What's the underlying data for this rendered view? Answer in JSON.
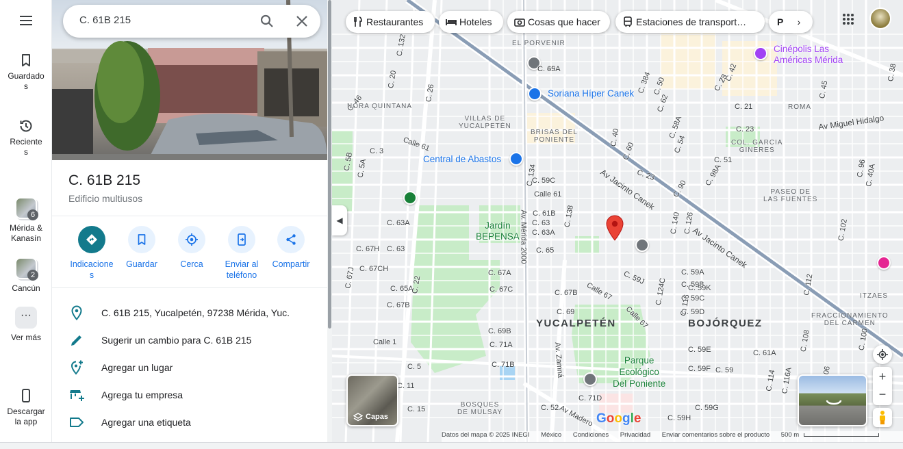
{
  "rail": {
    "menu_icon": "hamburger-menu-icon",
    "saved_label": "Guardado\ns",
    "recent_label": "Reciente\ns",
    "merida_label": "Mérida &\nKanasín",
    "merida_count": "6",
    "cancun_label": "Cancún",
    "cancun_count": "2",
    "more_label": "Ver más",
    "more_glyph": "···",
    "download_label": "Descargar\nla app"
  },
  "search": {
    "value": "C. 61B 215"
  },
  "place": {
    "title": "C. 61B 215",
    "type": "Edificio multiusos"
  },
  "actions": [
    {
      "label": "Indicacione\ns"
    },
    {
      "label": "Guardar"
    },
    {
      "label": "Cerca"
    },
    {
      "label": "Enviar al\nteléfono"
    },
    {
      "label": "Compartir"
    }
  ],
  "details": [
    {
      "text": "C. 61B 215, Yucalpetén, 97238 Mérida, Yuc."
    },
    {
      "text": "Sugerir un cambio para C. 61B 215"
    },
    {
      "text": "Agregar un lugar"
    },
    {
      "text": "Agrega tu empresa"
    },
    {
      "text": "Agregar una etiqueta"
    }
  ],
  "chips": [
    {
      "label": "Restaurantes"
    },
    {
      "label": "Hoteles"
    },
    {
      "label": "Cosas que hacer"
    },
    {
      "label": "Estaciones de transport…"
    },
    {
      "label": "P"
    }
  ],
  "map": {
    "big_labels": [
      "YUCALPETÉN",
      "BOJÓRQUEZ"
    ],
    "neighborhoods": [
      "EL PORVENIR",
      "NORA QUINTANA",
      "VILLAS DE\nYUCALPETÉN",
      "BRISAS DEL\nPONIENTE",
      "COL. GARCIA\nGINERES",
      "ROMA",
      "PASEO DE\nLAS FUENTES",
      "ITZAES",
      "FRACCIONAMIENTO\nDEL CARMEN",
      "BOSQUES\nDE MULSAY"
    ],
    "pois": [
      "Soriana Híper Canek",
      "Central de Abastos",
      "Cinépolis Las\nAméricas Mérida",
      "Jardín\nBEPENSA",
      "Parque\nEcológico\nDel Poniente"
    ],
    "avenues": [
      "Av Jacinto Canek",
      "Av Jacinto Canek",
      "Av Miguel Hidalgo",
      "Av. Mérida 2000",
      "Av. Zamná",
      "Av Madero",
      "Calle 61",
      "Calle 67",
      "Calle 67",
      "Calle 1",
      "Calle 61"
    ],
    "streets": [
      "C. 49",
      "C. 25",
      "C. 21",
      "C. 23",
      "C. 51",
      "C. 3",
      "C. 59C",
      "C. 61B",
      "C. 63",
      "C. 63A",
      "C. 65",
      "C. 67A",
      "C. 67C",
      "C. 67B",
      "C. 69",
      "C. 69B",
      "C. 71A",
      "C. 71B",
      "C. 71D",
      "C. 5",
      "C. 11",
      "C. 15",
      "C. 23",
      "C. 59A",
      "C. 59B",
      "C. 59C",
      "C. 59D",
      "C. 59E",
      "C. 59F",
      "C. 59G",
      "C. 59H",
      "C. 59J",
      "C. 59K",
      "C. 59",
      "C. 61A",
      "C. 63A",
      "C. 63",
      "C. 65A",
      "C. 67B",
      "C. 67CH",
      "C. 67H",
      "C. 67J",
      "C. 5B",
      "C. 5A",
      "C. 22",
      "C. 26",
      "C. 20",
      "C. 132",
      "C. 134",
      "C. 138",
      "C. 140",
      "C. 126",
      "C. 124C",
      "C. 116",
      "C. 114",
      "C. 116A",
      "C. 112",
      "C. 108",
      "C. 106",
      "C. 102",
      "C. 100",
      "C. 96",
      "C. 90",
      "C. 98A",
      "C. 42",
      "C. 40A",
      "C. 38",
      "C. 384",
      "C. 40",
      "C. 60",
      "C. 62",
      "C. 58A",
      "C. 54",
      "C. 50",
      "C. 45",
      "C. 46",
      "C. 52",
      "C. 65A",
      "C. 73"
    ],
    "footer": [
      "Datos del mapa © 2025 INEGI",
      "México",
      "Condiciones",
      "Privacidad",
      "Enviar comentarios sobre el producto",
      "500 m"
    ],
    "google": "Google",
    "layers_label": "Capas",
    "zoom_in": "+",
    "zoom_out": "−"
  },
  "colors": {
    "accent": "#1a73e8",
    "primary_action": "#137a8c",
    "pin_red": "#ea4335",
    "park": "#c8ecc8",
    "road": "#ffffff",
    "highway": "#8a9db5"
  }
}
